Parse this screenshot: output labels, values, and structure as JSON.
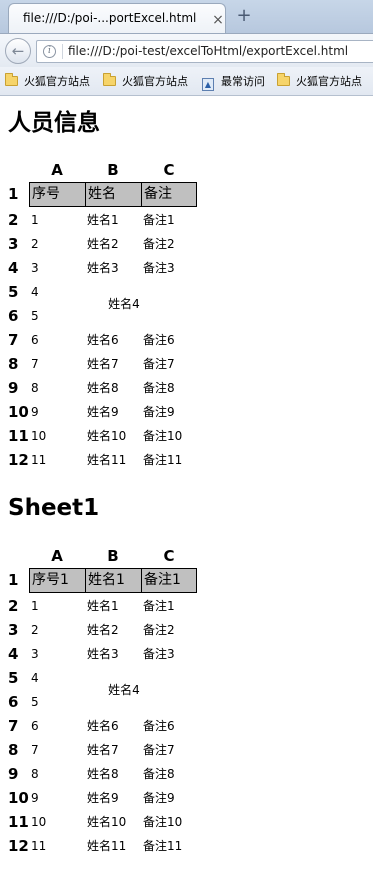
{
  "browser": {
    "tab_title": "file:///D:/poi-...portExcel.html",
    "tab_close": "×",
    "new_tab": "+",
    "url": "file:///D:/poi-test/excelToHtml/exportExcel.html",
    "bookmarks": [
      "火狐官方站点",
      "火狐官方站点",
      "最常访问",
      "火狐官方站点"
    ]
  },
  "sheets": [
    {
      "title": "人员信息",
      "columns": [
        "A",
        "B",
        "C"
      ],
      "header": [
        "序号",
        "姓名",
        "备注"
      ],
      "rows": [
        {
          "num": "2",
          "a": "1",
          "b": "姓名1",
          "c": "备注1"
        },
        {
          "num": "3",
          "a": "2",
          "b": "姓名2",
          "c": "备注2"
        },
        {
          "num": "4",
          "a": "3",
          "b": "姓名3",
          "c": "备注3"
        },
        {
          "num": "5",
          "a": "4",
          "b": "",
          "c": ""
        },
        {
          "num": "6",
          "a": "5",
          "b": "",
          "c": ""
        },
        {
          "num": "7",
          "a": "6",
          "b": "姓名6",
          "c": "备注6"
        },
        {
          "num": "8",
          "a": "7",
          "b": "姓名7",
          "c": "备注7"
        },
        {
          "num": "9",
          "a": "8",
          "b": "姓名8",
          "c": "备注8"
        },
        {
          "num": "10",
          "a": "9",
          "b": "姓名9",
          "c": "备注9"
        },
        {
          "num": "11",
          "a": "10",
          "b": "姓名10",
          "c": "备注10"
        },
        {
          "num": "12",
          "a": "11",
          "b": "姓名11",
          "c": "备注11"
        }
      ],
      "merged_text": "姓名4",
      "header_row_num": "1"
    },
    {
      "title": "Sheet1",
      "columns": [
        "A",
        "B",
        "C"
      ],
      "header": [
        "序号1",
        "姓名1",
        "备注1"
      ],
      "rows": [
        {
          "num": "2",
          "a": "1",
          "b": "姓名1",
          "c": "备注1"
        },
        {
          "num": "3",
          "a": "2",
          "b": "姓名2",
          "c": "备注2"
        },
        {
          "num": "4",
          "a": "3",
          "b": "姓名3",
          "c": "备注3"
        },
        {
          "num": "5",
          "a": "4",
          "b": "",
          "c": ""
        },
        {
          "num": "6",
          "a": "5",
          "b": "",
          "c": ""
        },
        {
          "num": "7",
          "a": "6",
          "b": "姓名6",
          "c": "备注6"
        },
        {
          "num": "8",
          "a": "7",
          "b": "姓名7",
          "c": "备注7"
        },
        {
          "num": "9",
          "a": "8",
          "b": "姓名8",
          "c": "备注8"
        },
        {
          "num": "10",
          "a": "9",
          "b": "姓名9",
          "c": "备注9"
        },
        {
          "num": "11",
          "a": "10",
          "b": "姓名10",
          "c": "备注10"
        },
        {
          "num": "12",
          "a": "11",
          "b": "姓名11",
          "c": "备注11"
        }
      ],
      "merged_text": "姓名4",
      "header_row_num": "1"
    }
  ]
}
